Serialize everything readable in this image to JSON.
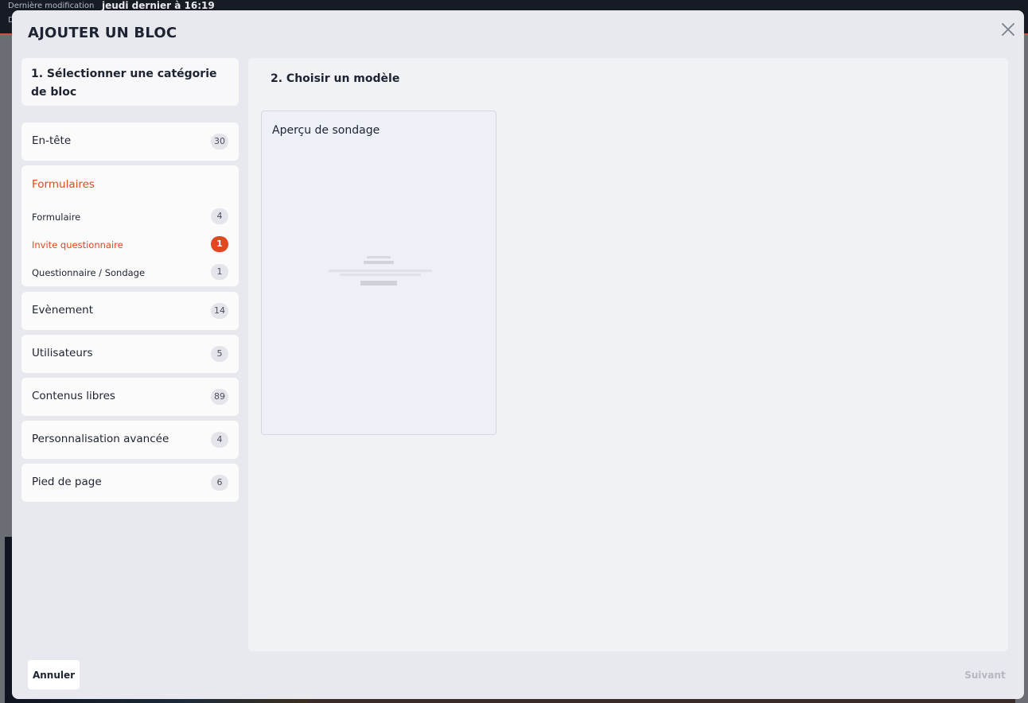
{
  "background": {
    "last_modified_label": "Dernière modification",
    "last_modified_value": "jeudi dernier à 16:19",
    "second_line_label": "D"
  },
  "modal": {
    "title": "AJOUTER UN BLOC",
    "close_icon": "close-icon",
    "step1": "1. Sélectionner une catégorie de bloc",
    "step2": "2. Choisir un modèle",
    "categories": [
      {
        "label": "En-tête",
        "count": "30"
      },
      {
        "label": "Formulaires",
        "active": true,
        "items": [
          {
            "label": "Formulaire",
            "count": "4"
          },
          {
            "label": "Invite questionnaire",
            "count": "1",
            "active": true
          },
          {
            "label": "Questionnaire / Sondage",
            "count": "1"
          }
        ]
      },
      {
        "label": "Evènement",
        "count": "14"
      },
      {
        "label": "Utilisateurs",
        "count": "5"
      },
      {
        "label": "Contenus libres",
        "count": "89"
      },
      {
        "label": "Personnalisation avancée",
        "count": "4"
      },
      {
        "label": "Pied de page",
        "count": "6"
      }
    ],
    "templates": [
      {
        "title": "Aperçu de sondage"
      }
    ],
    "cancel_label": "Annuler",
    "next_label": "Suivant"
  },
  "colors": {
    "accent": "#e0481f",
    "modal_bg": "#e8e9ee",
    "text": "#1d2332"
  }
}
